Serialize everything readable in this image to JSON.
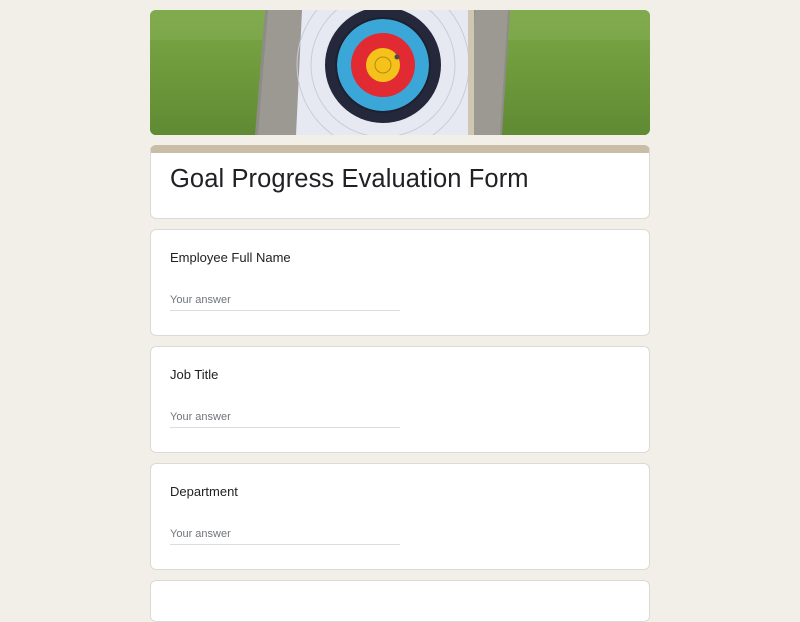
{
  "header_image": {
    "description_icon": "archery-target-image"
  },
  "form": {
    "title": "Goal Progress Evaluation Form",
    "accent_color": "#c9bda7",
    "questions": [
      {
        "label": "Employee Full Name",
        "placeholder": "Your answer"
      },
      {
        "label": "Job Title",
        "placeholder": "Your answer"
      },
      {
        "label": "Department",
        "placeholder": "Your answer"
      }
    ]
  }
}
